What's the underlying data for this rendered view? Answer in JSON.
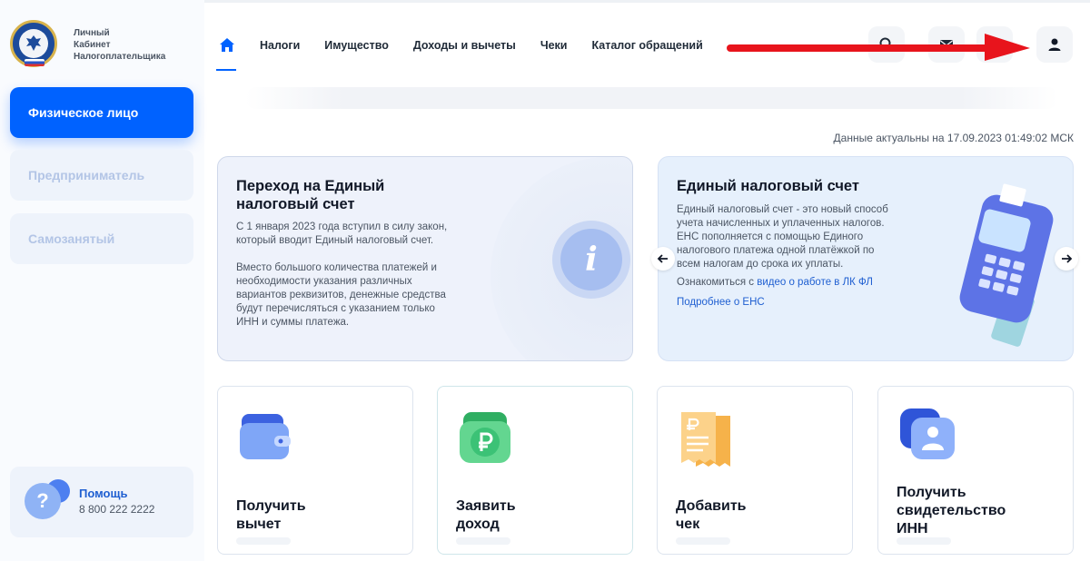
{
  "brand": {
    "line1": "Личный",
    "line2": "Кабинет",
    "line3": "Налогоплательщика"
  },
  "sidebar": {
    "roles": [
      {
        "label": "Физическое лицо",
        "active": true
      },
      {
        "label": "Предприниматель",
        "active": false
      },
      {
        "label": "Самозанятый",
        "active": false
      }
    ],
    "help": {
      "glyph": "?",
      "title": "Помощь",
      "phone": "8 800 222 2222"
    }
  },
  "nav": {
    "items": [
      "Налоги",
      "Имущество",
      "Доходы и вычеты",
      "Чеки",
      "Каталог обращений"
    ],
    "icons": [
      "search-icon",
      "mail-icon",
      "settings-icon",
      "user-icon"
    ]
  },
  "status": {
    "actual": "Данные актуальны на 17.09.2023 01:49:02 МСК"
  },
  "cards": {
    "card1": {
      "title_l1": "Переход на Единый",
      "title_l2": "налоговый счет",
      "p1_l1": "С 1 января 2023 года вступил в силу закон,",
      "p1_l2": "который вводит Единый налоговый счет.",
      "p2_l1": "Вместо большого количества платежей и",
      "p2_l2": "необходимости указания различных",
      "p2_l3": "вариантов реквизитов, денежные средства",
      "p2_l4": "будут перечисляться с указанием только",
      "p2_l5": "ИНН и суммы платежа.",
      "info_glyph": "i"
    },
    "card2": {
      "title": "Единый налоговый счет",
      "p_l1": "Единый налоговый счет - это новый способ",
      "p_l2": "учета начисленных и уплаченных налогов.",
      "p_l3": "ЕНС пополняется с помощью Единого",
      "p_l4": "налогового платежа одной платёжкой по",
      "p_l5": "всем налогам до срока их уплаты.",
      "link_prefix": "Ознакомиться с ",
      "link1": "видео о работе в ЛК ФЛ",
      "link2": "Подробнее о ЕНС"
    }
  },
  "tiles": [
    {
      "l1": "Получить",
      "l2": "вычет",
      "icon": "wallet-icon"
    },
    {
      "l1": "Заявить",
      "l2": "доход",
      "icon": "ruble-icon"
    },
    {
      "l1": "Добавить",
      "l2": "чек",
      "icon": "receipt-icon"
    },
    {
      "l1": "Получить",
      "l2": "свидетельство",
      "l3": "ИНН",
      "icon": "id-card-icon"
    }
  ],
  "colors": {
    "accent": "#0062ff",
    "link": "#1f5fd1",
    "arrow": "#e8141c"
  }
}
